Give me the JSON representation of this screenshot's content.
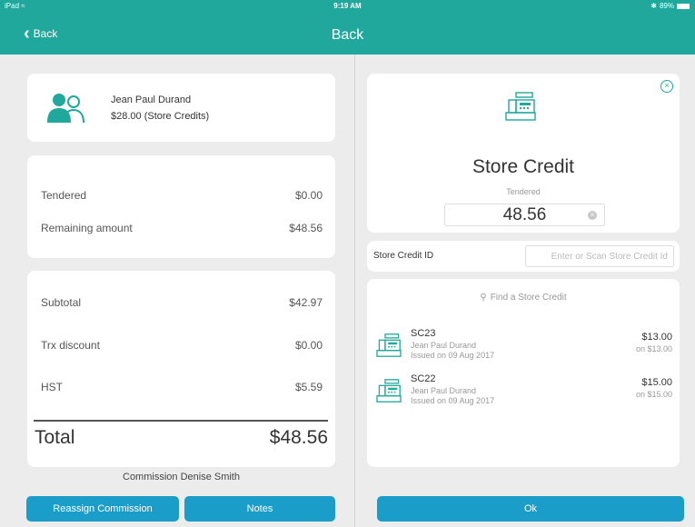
{
  "status_bar": {
    "device": "iPad",
    "time": "9:19 AM",
    "battery": "89%"
  },
  "nav": {
    "back_label": "Back",
    "title": "Back"
  },
  "customer": {
    "name": "Jean Paul Durand",
    "credit_text": "$28.00  (Store Credits)"
  },
  "tender": {
    "rows": [
      {
        "label": "Tendered",
        "value": "$0.00"
      },
      {
        "label": "Remaining amount",
        "value": "$48.56"
      }
    ]
  },
  "totals": {
    "rows": [
      {
        "label": "Subtotal",
        "value": "$42.97"
      },
      {
        "label": "Trx discount",
        "value": "$0.00"
      },
      {
        "label": "HST",
        "value": "$5.59"
      }
    ],
    "total_label": "Total",
    "total_value": "$48.56"
  },
  "commission_text": "Commission Denise Smith",
  "buttons": {
    "reassign": "Reassign Commission",
    "notes": "Notes",
    "ok": "Ok"
  },
  "store_credit": {
    "title": "Store Credit",
    "subtitle": "Tendered",
    "amount": "48.56",
    "id_label": "Store Credit ID",
    "id_placeholder": "Enter or Scan Store Credit Id",
    "find_label": "Find a Store Credit",
    "items": [
      {
        "code": "SC23",
        "holder": "Jean Paul Durand",
        "issued": "Issued on 09 Aug 2017",
        "amount": "$13.00",
        "on": "on $13.00"
      },
      {
        "code": "SC22",
        "holder": "Jean Paul Durand",
        "issued": "Issued on 09 Aug 2017",
        "amount": "$15.00",
        "on": "on $15.00"
      }
    ]
  },
  "colors": {
    "brand": "#1fa89b",
    "button": "#1a9ec9",
    "background": "#ececec"
  },
  "icons": [
    "back-chevron-icon",
    "wifi-icon",
    "bluetooth-icon",
    "battery-icon",
    "users-icon",
    "close-circle-icon",
    "cash-register-icon",
    "clear-icon",
    "search-icon"
  ]
}
